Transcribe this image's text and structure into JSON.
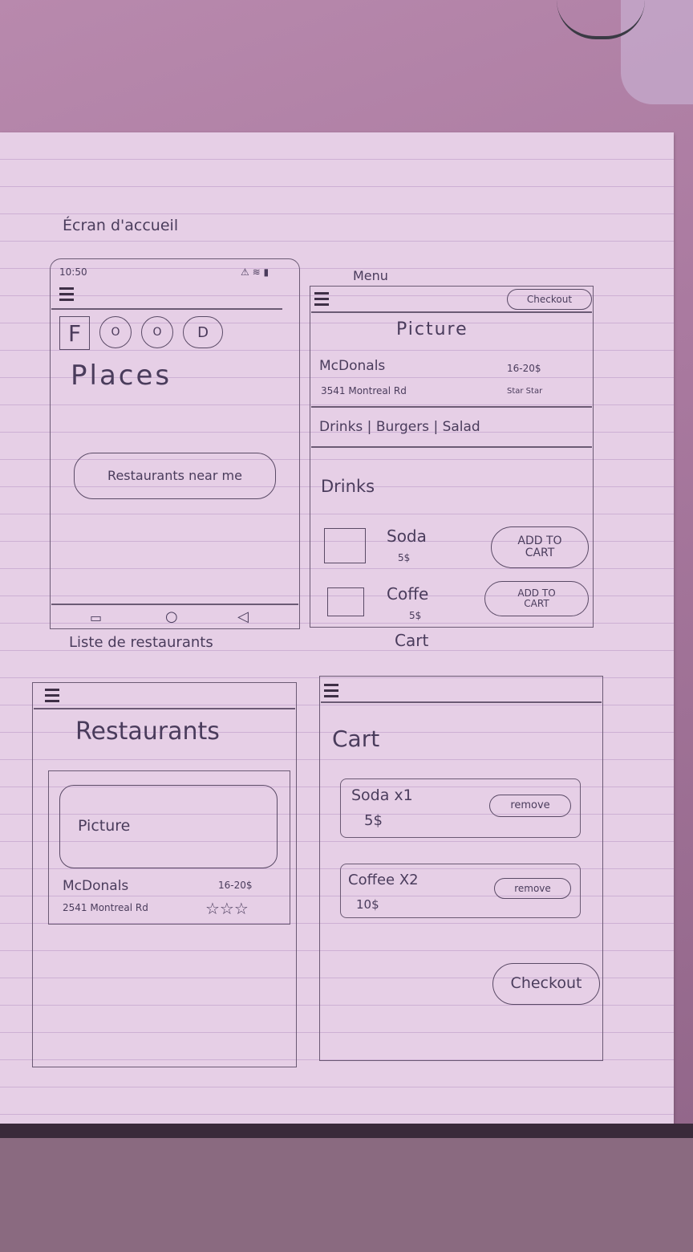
{
  "accueil": {
    "caption": "Écran d'accueil",
    "status_time": "10:50",
    "logo_letters": [
      "F",
      "O",
      "O",
      "D"
    ],
    "subtitle": "Places",
    "button": "Restaurants near me"
  },
  "liste": {
    "caption": "Liste de restaurants",
    "title": "Restaurants",
    "card_picture": "Picture",
    "name": "McDonals",
    "hours": "16-20$",
    "address": "2541 Montreal Rd",
    "stars": "☆☆☆"
  },
  "menu": {
    "caption": "Menu",
    "checkout": "Checkout",
    "picture": "Picture",
    "name": "McDonals",
    "address": "3541 Montreal Rd",
    "hours": "16-20$",
    "rating": "Star Star",
    "categories": "Drinks | Burgers | Salad",
    "section": "Drinks",
    "items": [
      {
        "name": "Soda",
        "price": "5$",
        "button": "ADD TO CART"
      },
      {
        "name": "Coffe",
        "price": "5$",
        "button": "ADD TO CART"
      }
    ]
  },
  "cart": {
    "caption": "Cart",
    "title": "Cart",
    "items": [
      {
        "line": "Soda x1",
        "price": "5$",
        "button": "remove"
      },
      {
        "line": "Coffee X2",
        "price": "10$",
        "button": "remove"
      }
    ],
    "checkout": "Checkout"
  }
}
